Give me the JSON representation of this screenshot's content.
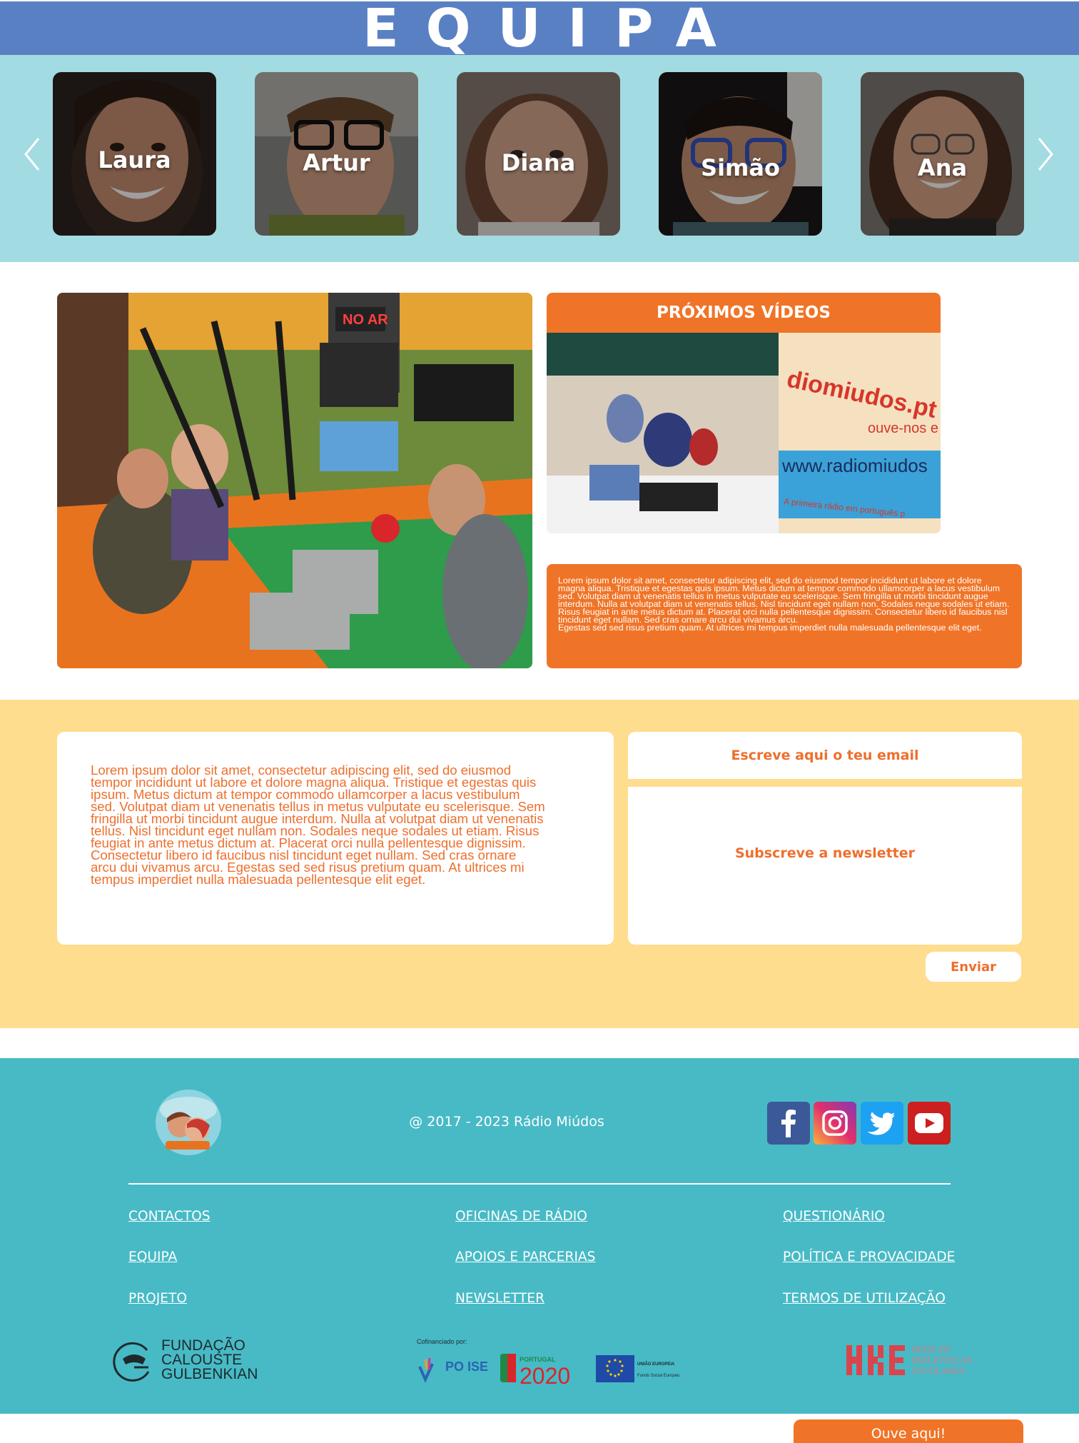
{
  "team": {
    "title": "EQUIPA",
    "members": [
      {
        "name": "Laura"
      },
      {
        "name": "Artur"
      },
      {
        "name": "Diana"
      },
      {
        "name": "Simão"
      },
      {
        "name": "Ana"
      }
    ]
  },
  "media": {
    "next_videos_title": "PRÓXIMOS VÍDEOS",
    "next_videos_banner_text": "ouve-nos e",
    "next_videos_banner_url": "www.radiomiudos",
    "next_videos_banner_brand": "diomiudos.pt",
    "next_videos_banner_tagline": "A primeira rádio em português p",
    "studio_sign": "NO AR",
    "info_paragraph_1": "Lorem ipsum dolor sit amet, consectetur adipiscing elit, sed do eiusmod tempor incididunt ut labore et dolore magna aliqua. Tristique et egestas quis ipsum. Metus dictum at tempor commodo ullamcorper a lacus vestibulum sed. Volutpat diam ut venenatis tellus in metus vulputate eu scelerisque. Sem fringilla ut morbi tincidunt augue interdum. Nulla at volutpat diam ut venenatis tellus. Nisl tincidunt eget nullam non. Sodales neque sodales ut etiam. Risus feugiat in ante metus dictum at. Placerat orci nulla pellentesque dignissim. Consectetur libero id faucibus nisl tincidunt eget nullam. Sed cras ornare arcu dui vivamus arcu.",
    "info_paragraph_2": "Egestas sed sed risus pretium quam. At ultrices mi tempus imperdiet nulla malesuada pellentesque elit eget."
  },
  "newsletter": {
    "body_text": "Lorem ipsum dolor sit amet, consectetur adipiscing elit, sed do eiusmod tempor incididunt ut labore et dolore magna aliqua. Tristique et egestas quis ipsum. Metus dictum at tempor commodo ullamcorper a lacus vestibulum sed. Volutpat diam ut venenatis tellus in metus vulputate eu scelerisque. Sem fringilla ut morbi tincidunt augue interdum. Nulla at volutpat diam ut venenatis tellus. Nisl tincidunt eget nullam non. Sodales neque sodales ut etiam. Risus feugiat in ante metus dictum at. Placerat orci nulla pellentesque dignissim. Consectetur libero id faucibus nisl tincidunt eget nullam. Sed cras ornare arcu dui vivamus arcu. Egestas sed sed risus pretium quam. At ultrices mi tempus imperdiet nulla malesuada pellentesque elit eget.",
    "email_placeholder": "Escreve aqui o teu email",
    "message_placeholder": "Subscreve a newsletter",
    "send_label": "Enviar"
  },
  "footer": {
    "copyright": "@ 2017 - 2023 Rádio Miúdos",
    "social": [
      {
        "name": "facebook",
        "color": "#3b5998"
      },
      {
        "name": "instagram",
        "color": "#c13584"
      },
      {
        "name": "twitter",
        "color": "#1da1f2"
      },
      {
        "name": "youtube",
        "color": "#cc1f1f"
      }
    ],
    "links": {
      "col1": [
        "CONTACTOS",
        "EQUIPA",
        "PROJETO"
      ],
      "col2": [
        "OFICINAS DE RÁDIO",
        "APOIOS E PARCERIAS",
        "NEWSLETTER"
      ],
      "col3": [
        "QUESTIONÁRIO",
        "POLÍTICA E PROVACIDADE",
        "TERMOS DE UTILIZAÇÃO"
      ]
    },
    "gulbenkian_lines": [
      "FUNDAÇÃO",
      "CALOUSTE",
      "GULBENKIAN"
    ],
    "funding_caption": "Cofinanciado por:",
    "funding_poise": "PO ISE",
    "funding_portugal": "PORTUGAL",
    "funding_2020": "2020",
    "funding_eu": "UNIÃO EUROPEIA",
    "funding_eu_sub": "Fundo Social Europeu",
    "rbe_lines": [
      "REDE DE",
      "BIBLIOTECAS",
      "ESCOLARES"
    ],
    "listen_label": "Ouve aqui!"
  },
  "colors": {
    "header_blue": "#5a80c4",
    "strip_teal": "#a3dbe2",
    "accent_orange": "#f07427",
    "newsletter_yellow": "#ffdd8f",
    "footer_teal": "#47bac6"
  }
}
